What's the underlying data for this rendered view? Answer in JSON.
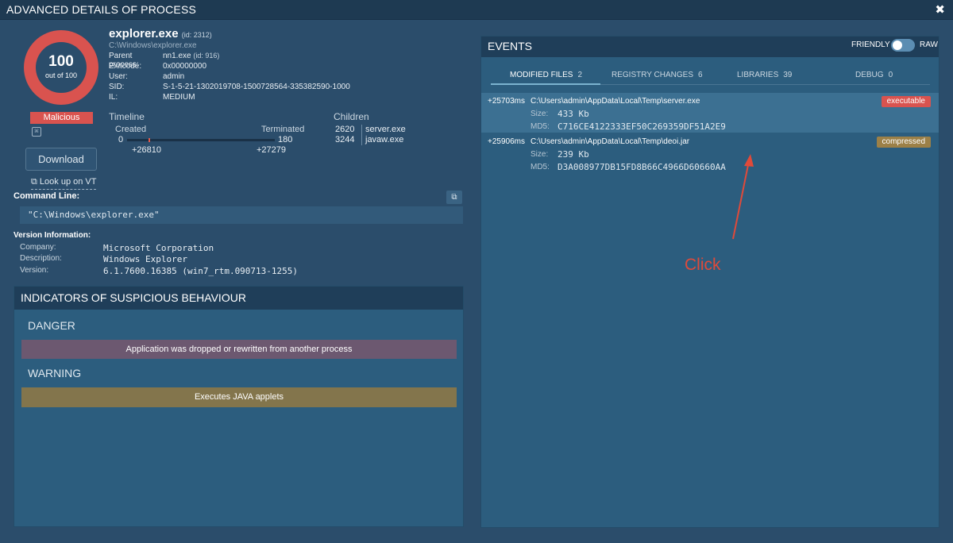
{
  "window": {
    "title": "ADVANCED DETAILS OF PROCESS",
    "close": "✖"
  },
  "score": {
    "value": "100",
    "of": "out of 100",
    "verdict": "Malicious",
    "color": "#d9534f"
  },
  "actions": {
    "download": "Download",
    "lookup": "Look up on VT"
  },
  "process": {
    "name": "explorer.exe",
    "id": "(id: 2312)",
    "path": "C:\\Windows\\explorer.exe",
    "fields": [
      {
        "key": "Parent process:",
        "value": "nn1.exe",
        "extra": "(id: 916)"
      },
      {
        "key": "Exitcode:",
        "value": "0x00000000",
        "extra": ""
      },
      {
        "key": "User:",
        "value": "admin",
        "extra": ""
      },
      {
        "key": "SID:",
        "value": "S-1-5-21-1302019708-1500728564-335382590-1000",
        "extra": ""
      },
      {
        "key": "IL:",
        "value": "MEDIUM",
        "extra": ""
      }
    ]
  },
  "timeline": {
    "title": "Timeline",
    "created_label": "Created",
    "terminated_label": "Terminated",
    "start": "0",
    "end": "180",
    "created": "+26810",
    "terminated": "+27279"
  },
  "children": {
    "title": "Children",
    "items": [
      {
        "pid": "2620",
        "name": "server.exe"
      },
      {
        "pid": "3244",
        "name": "javaw.exe"
      }
    ]
  },
  "command_line": {
    "label": "Command Line:",
    "value": "\"C:\\Windows\\explorer.exe\""
  },
  "version": {
    "label": "Version Information:",
    "rows": [
      {
        "key": "Company:",
        "value": "Microsoft Corporation"
      },
      {
        "key": "Description:",
        "value": "Windows Explorer"
      },
      {
        "key": "Version:",
        "value": "6.1.7600.16385 (win7_rtm.090713-1255)"
      }
    ]
  },
  "indicators": {
    "title": "INDICATORS OF SUSPICIOUS BEHAVIOUR",
    "danger_title": "DANGER",
    "danger_item": "Application was dropped or rewritten from another process",
    "warning_title": "WARNING",
    "warning_item": "Executes JAVA applets"
  },
  "events": {
    "title": "EVENTS",
    "friendly": "FRIENDLY",
    "raw": "RAW",
    "tabs": [
      {
        "label": "MODIFIED FILES",
        "count": "2"
      },
      {
        "label": "REGISTRY CHANGES",
        "count": "6"
      },
      {
        "label": "LIBRARIES",
        "count": "39"
      },
      {
        "label": "DEBUG",
        "count": "0"
      }
    ],
    "rows": [
      {
        "time": "+25703ms",
        "path": "C:\\Users\\admin\\AppData\\Local\\Temp\\server.exe",
        "size_label": "Size:",
        "size": "433 Kb",
        "md5_label": "MD5:",
        "md5": "C716CE4122333EF50C269359DF51A2E9",
        "badge": "executable",
        "badge_color": "#d9534f"
      },
      {
        "time": "+25906ms",
        "path": "C:\\Users\\admin\\AppData\\Local\\Temp\\deoi.jar",
        "size_label": "Size:",
        "size": "239 Kb",
        "md5_label": "MD5:",
        "md5": "D3A008977DB15FD8B66C4966D60660AA",
        "badge": "compressed",
        "badge_color": "#9c8047"
      }
    ]
  },
  "annotation": {
    "text": "Click",
    "color": "#e04a3a"
  }
}
